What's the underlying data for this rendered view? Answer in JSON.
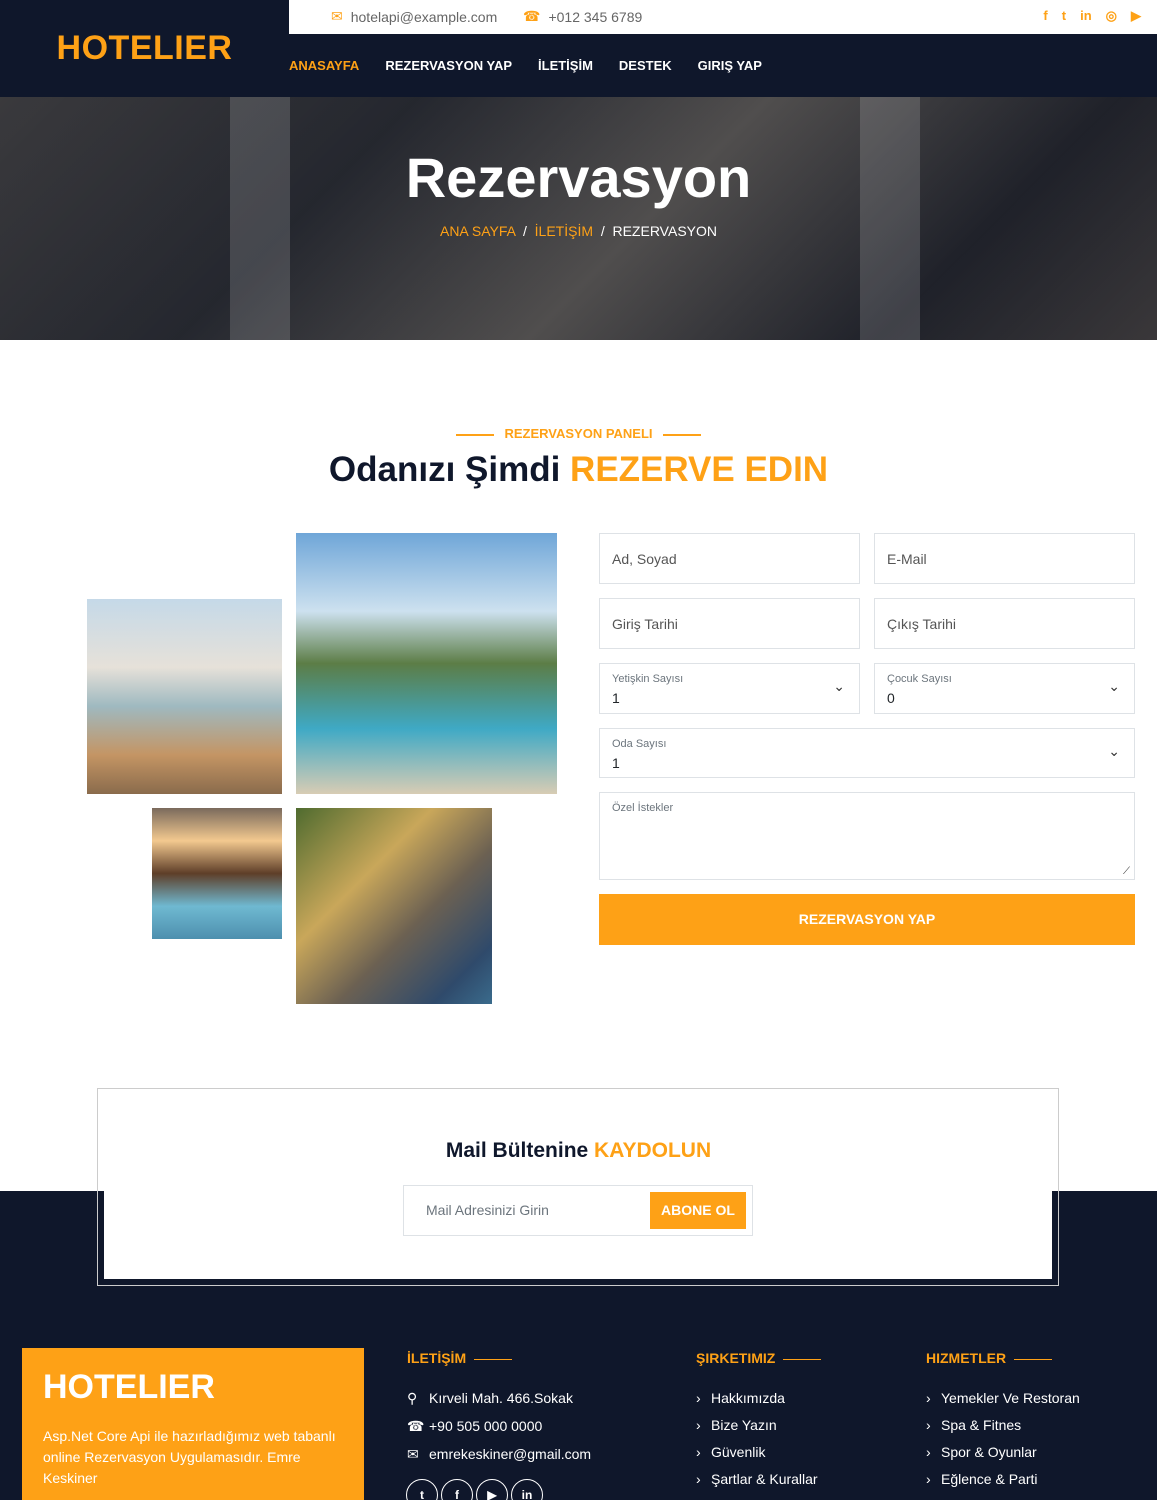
{
  "brand": {
    "logo": "HOTELIER"
  },
  "topbar": {
    "email": "hotelapi@example.com",
    "phone": "+012 345 6789"
  },
  "nav": [
    "ANASAYFA",
    "REZERVASYON YAP",
    "İLETİŞİM",
    "DESTEK",
    "GIRIŞ YAP"
  ],
  "hero": {
    "title": "Rezervasyon",
    "crumb_home": "ANA SAYFA",
    "crumb_sep": "/",
    "crumb_mid": "İLETİŞİM",
    "crumb_current": "REZERVASYON"
  },
  "section": {
    "subtitle": "REZERVASYON PANELI",
    "title_part1": "Odanızı Şimdi ",
    "title_highlight": "REZERVE EDIN"
  },
  "form": {
    "name_placeholder": "Ad, Soyad",
    "email_placeholder": "E-Mail",
    "checkin_placeholder": "Giriş Tarihi",
    "checkout_placeholder": "Çıkış Tarihi",
    "adults_label": "Yetişkin Sayısı",
    "adults_value": "1",
    "children_label": "Çocuk Sayısı",
    "children_value": "0",
    "rooms_label": "Oda Sayısı",
    "rooms_value": "1",
    "notes_label": "Özel İstekler",
    "submit_label": "REZERVASYON YAP"
  },
  "newsletter": {
    "title_part1": "Mail Bültenine ",
    "title_highlight": "KAYDOLUN",
    "placeholder": "Mail Adresinizi Girin",
    "button": "ABONE OL"
  },
  "footer": {
    "brand": "HOTELIER",
    "description": "Asp.Net Core Api ile hazırladığımız web tabanlı online Rezervasyon Uygulamasıdır. Emre Keskiner",
    "contact_heading": "İLETİŞİM",
    "address": "Kırveli Mah. 466.Sokak",
    "phone": "+90 505 000 0000",
    "email": "emrekeskiner@gmail.com",
    "company_heading": "ŞIRKETIMIZ",
    "company_links": [
      "Hakkımızda",
      "Bize Yazın",
      "Güvenlik",
      "Şartlar & Kurallar"
    ],
    "services_heading": "HIZMETLER",
    "services_links": [
      "Yemekler Ve Restoran",
      "Spa & Fitnes",
      "Spor & Oyunlar",
      "Eğlence & Parti"
    ]
  },
  "colors": {
    "accent": "#FEA116",
    "dark": "#0F172B"
  },
  "icons": {
    "social_top": [
      "facebook-icon",
      "twitter-icon",
      "linkedin-icon",
      "instagram-icon",
      "youtube-icon"
    ],
    "social_footer": [
      "twitter-icon",
      "facebook-icon",
      "youtube-icon",
      "linkedin-icon"
    ]
  }
}
